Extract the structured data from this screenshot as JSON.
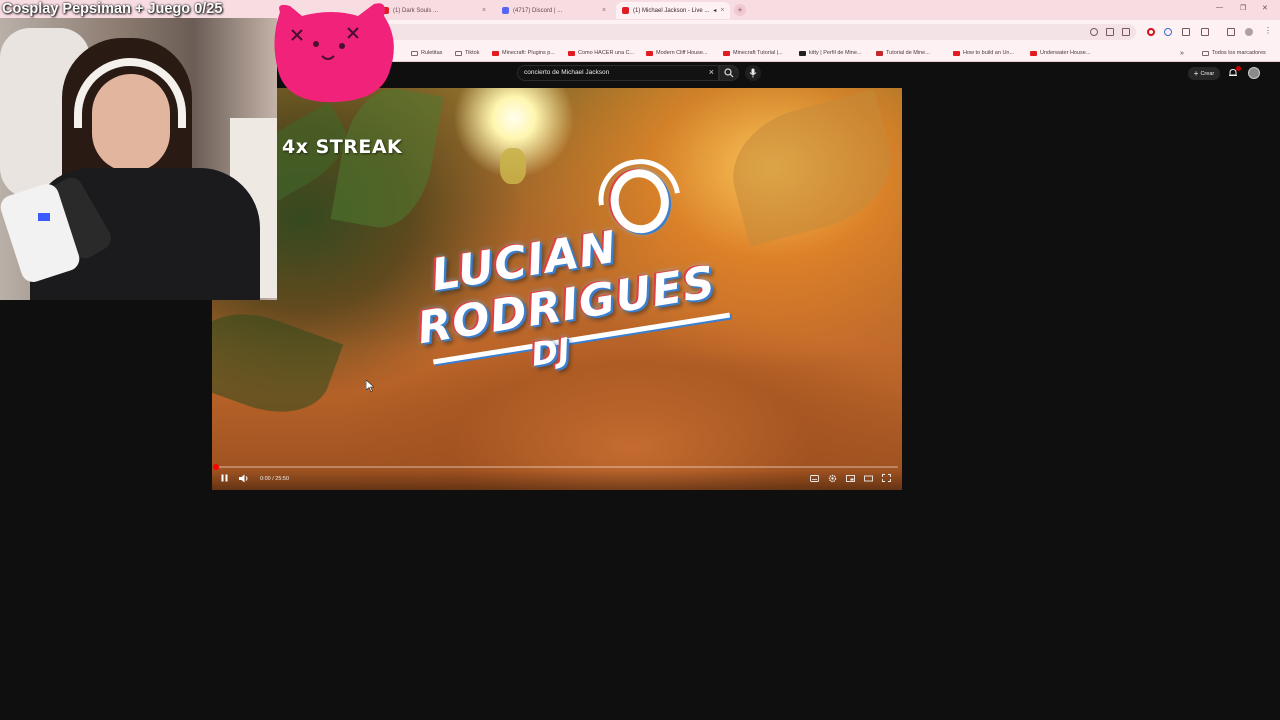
{
  "overlay": {
    "stream_title": "Cosplay Pepsiman + Juego 0/25"
  },
  "browser": {
    "tabs": [
      {
        "label": "(1) Dark Souls ..."
      },
      {
        "label": "(4717) Discord | ..."
      },
      {
        "label": "(1) Michael Jackson - Live ..."
      }
    ],
    "bookmarks": [
      {
        "label": "Ruletitas",
        "icon": "folder-icon"
      },
      {
        "label": "Tiktok",
        "icon": "folder-icon"
      },
      {
        "label": "Minecraft: Plugins p...",
        "icon": "youtube-icon"
      },
      {
        "label": "Como HACER una C...",
        "icon": "youtube-icon"
      },
      {
        "label": "Modern Cliff House...",
        "icon": "youtube-icon"
      },
      {
        "label": "Minecraft Tutorial |...",
        "icon": "youtube-icon"
      },
      {
        "label": "kitty | Perfil de Mine...",
        "icon": "site-icon"
      },
      {
        "label": "Tutorial de Mine...",
        "icon": "site-icon"
      },
      {
        "label": "How to build an Un...",
        "icon": "youtube-icon"
      },
      {
        "label": "Underwater House...",
        "icon": "youtube-icon"
      }
    ],
    "all_bookmarks_label": "Todos los marcadores",
    "chevron": "»"
  },
  "youtube": {
    "search_value": "concierto de Michael Jackson",
    "create_label": "Crear"
  },
  "video": {
    "streak_text": "4x STREAK",
    "logo_line1": "LUCIAN",
    "logo_line2": "RODRIGUES",
    "logo_line3": "DJ",
    "time": "0:00 / 25:50",
    "progress": 0.0,
    "colors": {
      "progress": "#ff0000"
    }
  }
}
